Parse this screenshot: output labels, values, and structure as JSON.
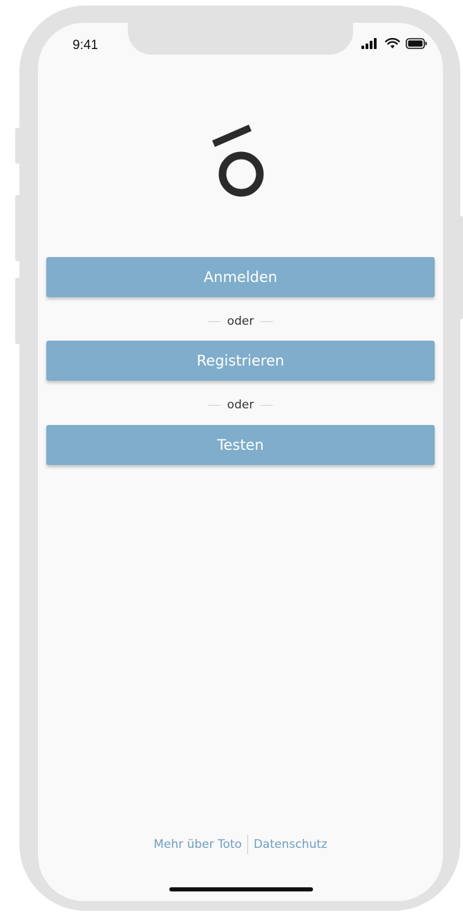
{
  "status_bar": {
    "time": "9:41",
    "icons": [
      "signal-icon",
      "wifi-icon",
      "battery-icon"
    ]
  },
  "logo": {
    "name": "toto-logo-icon"
  },
  "buttons": {
    "login": "Anmelden",
    "register": "Registrieren",
    "test": "Testen"
  },
  "dividers": {
    "first": "oder",
    "second": "oder"
  },
  "footer": {
    "about": "Mehr über Toto",
    "privacy": "Datenschutz"
  },
  "colors": {
    "button": "#7fadcb",
    "link": "#6e9fc1",
    "background": "#f9f9f9",
    "frame": "#e2e2e2"
  }
}
